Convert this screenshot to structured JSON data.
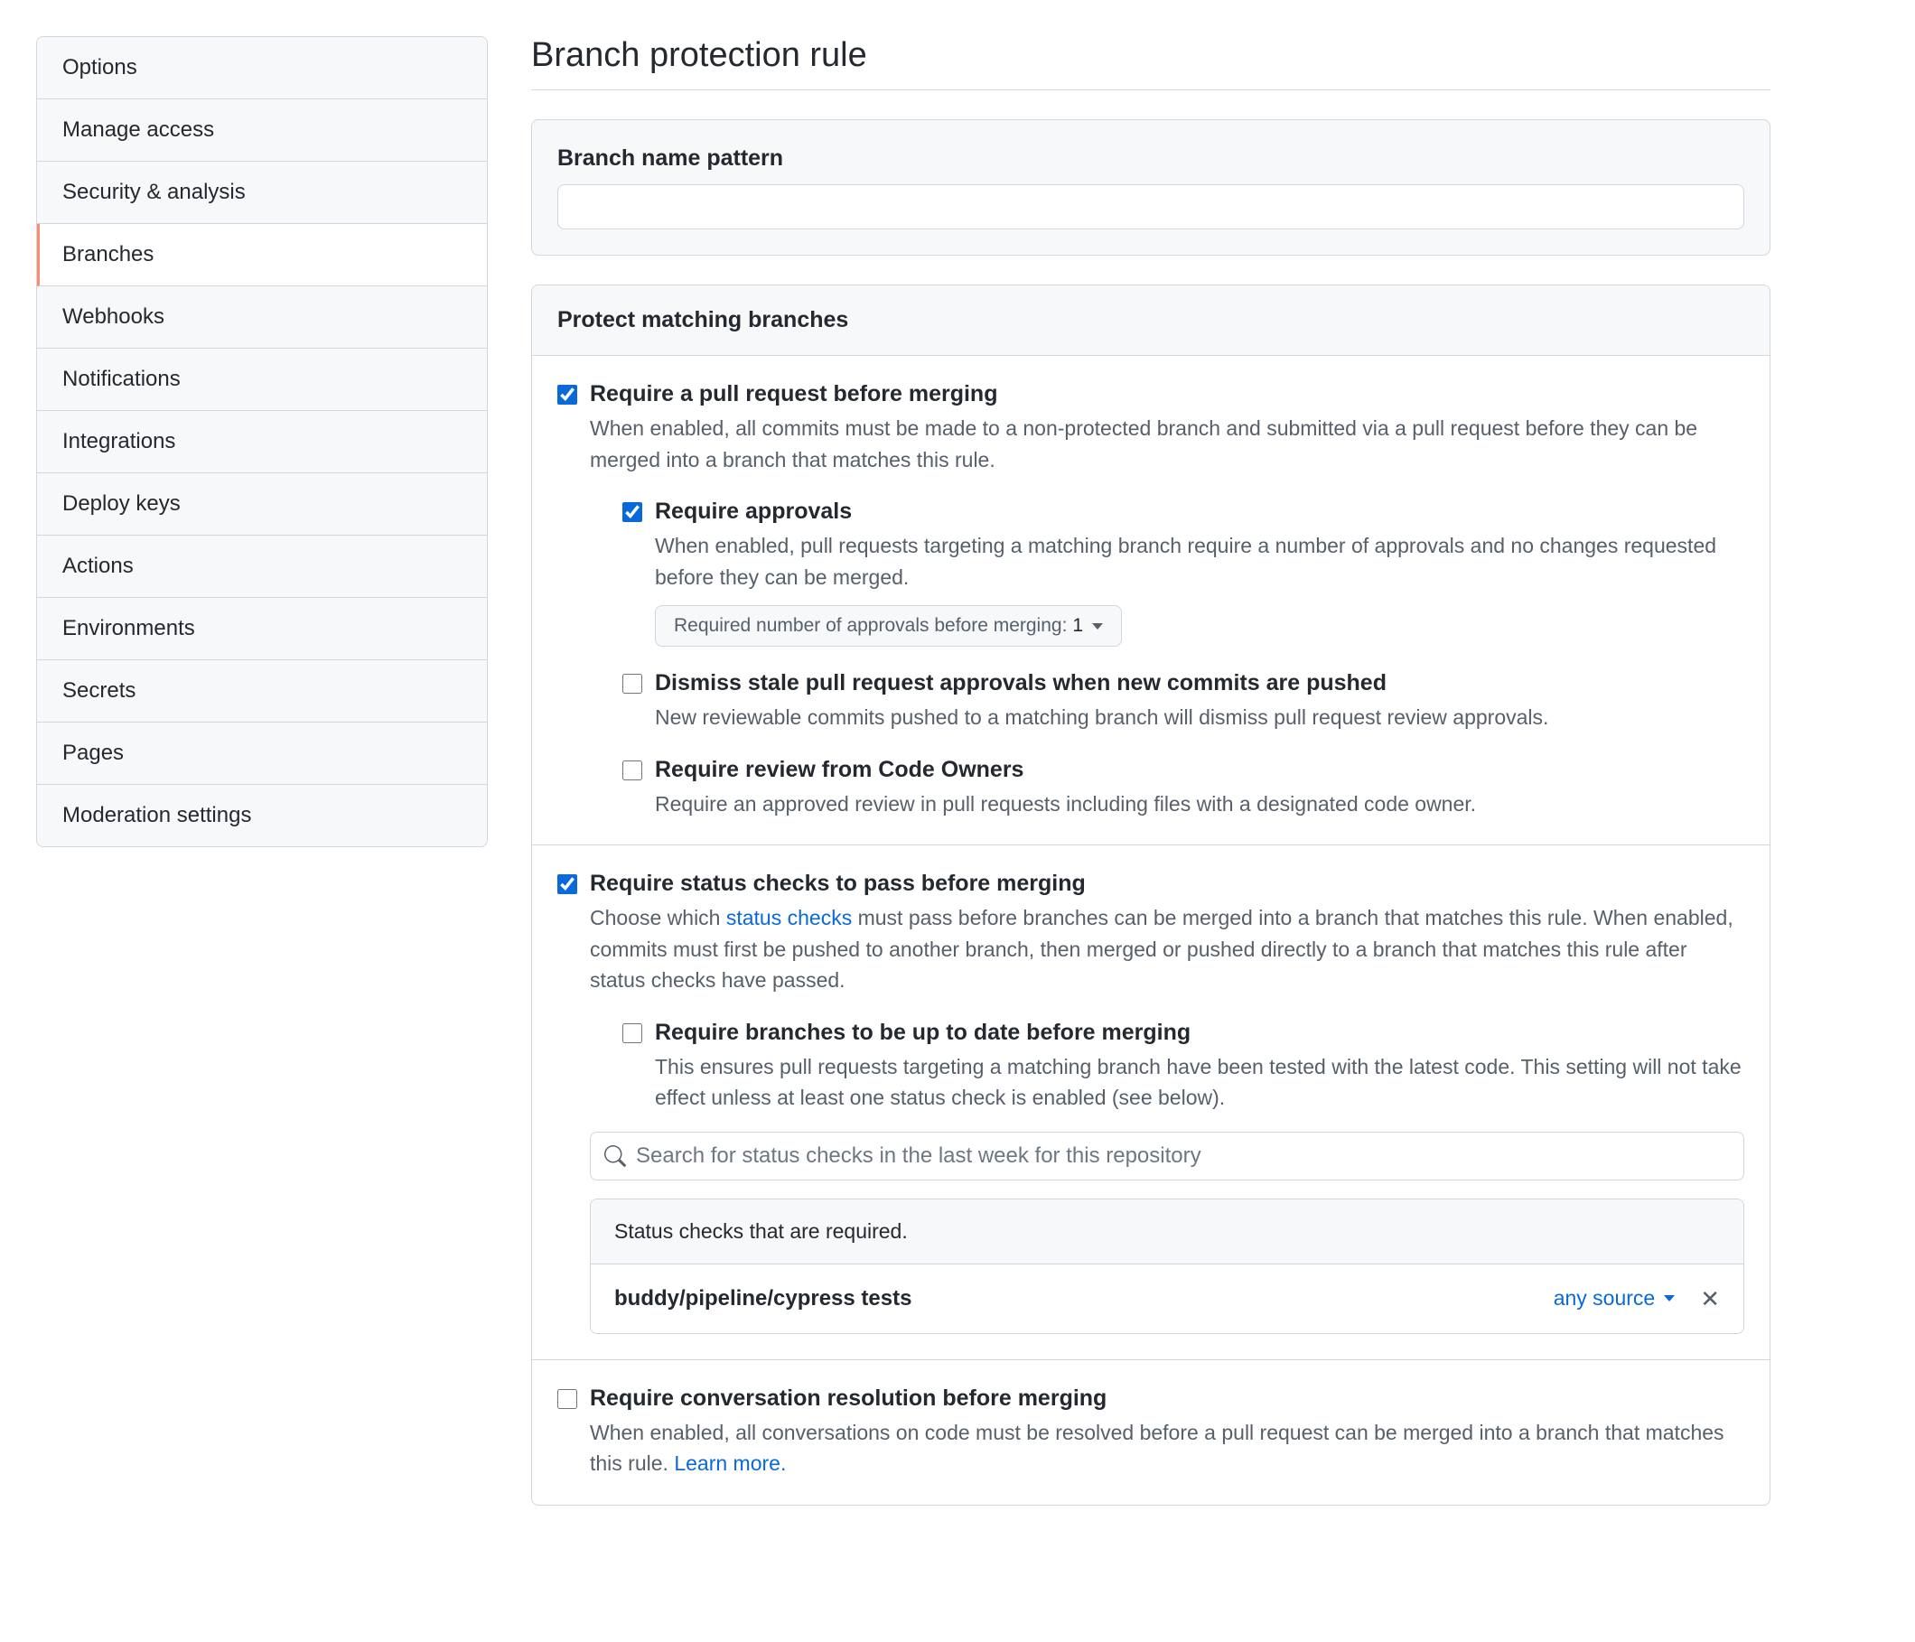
{
  "sidebar": {
    "items": [
      {
        "label": "Options",
        "active": false
      },
      {
        "label": "Manage access",
        "active": false
      },
      {
        "label": "Security & analysis",
        "active": false
      },
      {
        "label": "Branches",
        "active": true
      },
      {
        "label": "Webhooks",
        "active": false
      },
      {
        "label": "Notifications",
        "active": false
      },
      {
        "label": "Integrations",
        "active": false
      },
      {
        "label": "Deploy keys",
        "active": false
      },
      {
        "label": "Actions",
        "active": false
      },
      {
        "label": "Environments",
        "active": false
      },
      {
        "label": "Secrets",
        "active": false
      },
      {
        "label": "Pages",
        "active": false
      },
      {
        "label": "Moderation settings",
        "active": false
      }
    ]
  },
  "page": {
    "title": "Branch protection rule"
  },
  "pattern": {
    "label": "Branch name pattern",
    "value": ""
  },
  "protect": {
    "header": "Protect matching branches",
    "require_pr": {
      "checked": true,
      "title": "Require a pull request before merging",
      "desc": "When enabled, all commits must be made to a non-protected branch and submitted via a pull request before they can be merged into a branch that matches this rule."
    },
    "require_approvals": {
      "checked": true,
      "title": "Require approvals",
      "desc": "When enabled, pull requests targeting a matching branch require a number of approvals and no changes requested before they can be merged.",
      "dropdown_label": "Required number of approvals before merging: ",
      "dropdown_value": "1"
    },
    "dismiss_stale": {
      "checked": false,
      "title": "Dismiss stale pull request approvals when new commits are pushed",
      "desc": "New reviewable commits pushed to a matching branch will dismiss pull request review approvals."
    },
    "code_owners": {
      "checked": false,
      "title": "Require review from Code Owners",
      "desc": "Require an approved review in pull requests including files with a designated code owner."
    },
    "status_checks": {
      "checked": true,
      "title": "Require status checks to pass before merging",
      "desc_pre": "Choose which ",
      "desc_link": "status checks",
      "desc_post": " must pass before branches can be merged into a branch that matches this rule. When enabled, commits must first be pushed to another branch, then merged or pushed directly to a branch that matches this rule after status checks have passed."
    },
    "up_to_date": {
      "checked": false,
      "title": "Require branches to be up to date before merging",
      "desc": "This ensures pull requests targeting a matching branch have been tested with the latest code. This setting will not take effect unless at least one status check is enabled (see below)."
    },
    "search_placeholder": "Search for status checks in the last week for this repository",
    "checks_header": "Status checks that are required.",
    "check_item": {
      "name": "buddy/pipeline/cypress tests",
      "source_label": "any source"
    },
    "conversation": {
      "checked": false,
      "title": "Require conversation resolution before merging",
      "desc_pre": "When enabled, all conversations on code must be resolved before a pull request can be merged into a branch that matches this rule. ",
      "desc_link": "Learn more."
    }
  }
}
